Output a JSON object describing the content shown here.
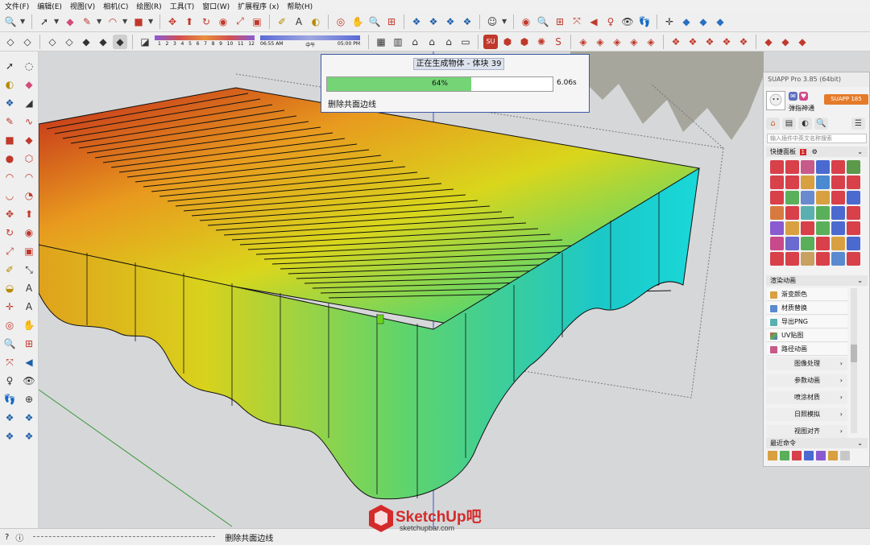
{
  "menu": [
    "文件(F)",
    "编辑(E)",
    "视图(V)",
    "相机(C)",
    "绘图(R)",
    "工具(T)",
    "窗口(W)",
    "扩展程序 (x)",
    "帮助(H)"
  ],
  "shadow_slider": {
    "scale": [
      "1",
      "2",
      "3",
      "4",
      "5",
      "6",
      "7",
      "8",
      "9",
      "10",
      "11",
      "12"
    ],
    "time_start": "06:55 AM",
    "time_mid": "中午",
    "time_end": "05:00 PM"
  },
  "progress_dialog": {
    "title": "正在生成物体 - 体块 39",
    "percent": "64%",
    "percent_value": 0.64,
    "time": "6.06s",
    "status": "删除共面边线"
  },
  "suapp": {
    "title": "SUAPP Pro 3.85 (64bit)",
    "user_name": "弹指神通",
    "upgrade_button": "SUAPP 185",
    "search_placeholder": "输入插件中英文名称搜索",
    "quick_panel": "快捷面板",
    "quick_badge": "1",
    "section_anim": "渲染动画",
    "items": [
      "渐变颜色",
      "材质替换",
      "导出PNG",
      "UV贴图",
      "路径动画"
    ],
    "submenus": [
      "图像处理",
      "参数动画",
      "喷涂材质",
      "日照模拟",
      "视图对齐"
    ],
    "recent_commands": "最近命令"
  },
  "status_bar": {
    "text": "删除共面边线"
  },
  "watermark": {
    "brand": "SketchUp吧",
    "url": "sketchupbar.com"
  },
  "colors": {
    "progress_fill": "#74d476",
    "dialog_border": "#3b5ba8",
    "brand_red": "#d42a2a",
    "upgrade_orange": "#e57b2a"
  }
}
